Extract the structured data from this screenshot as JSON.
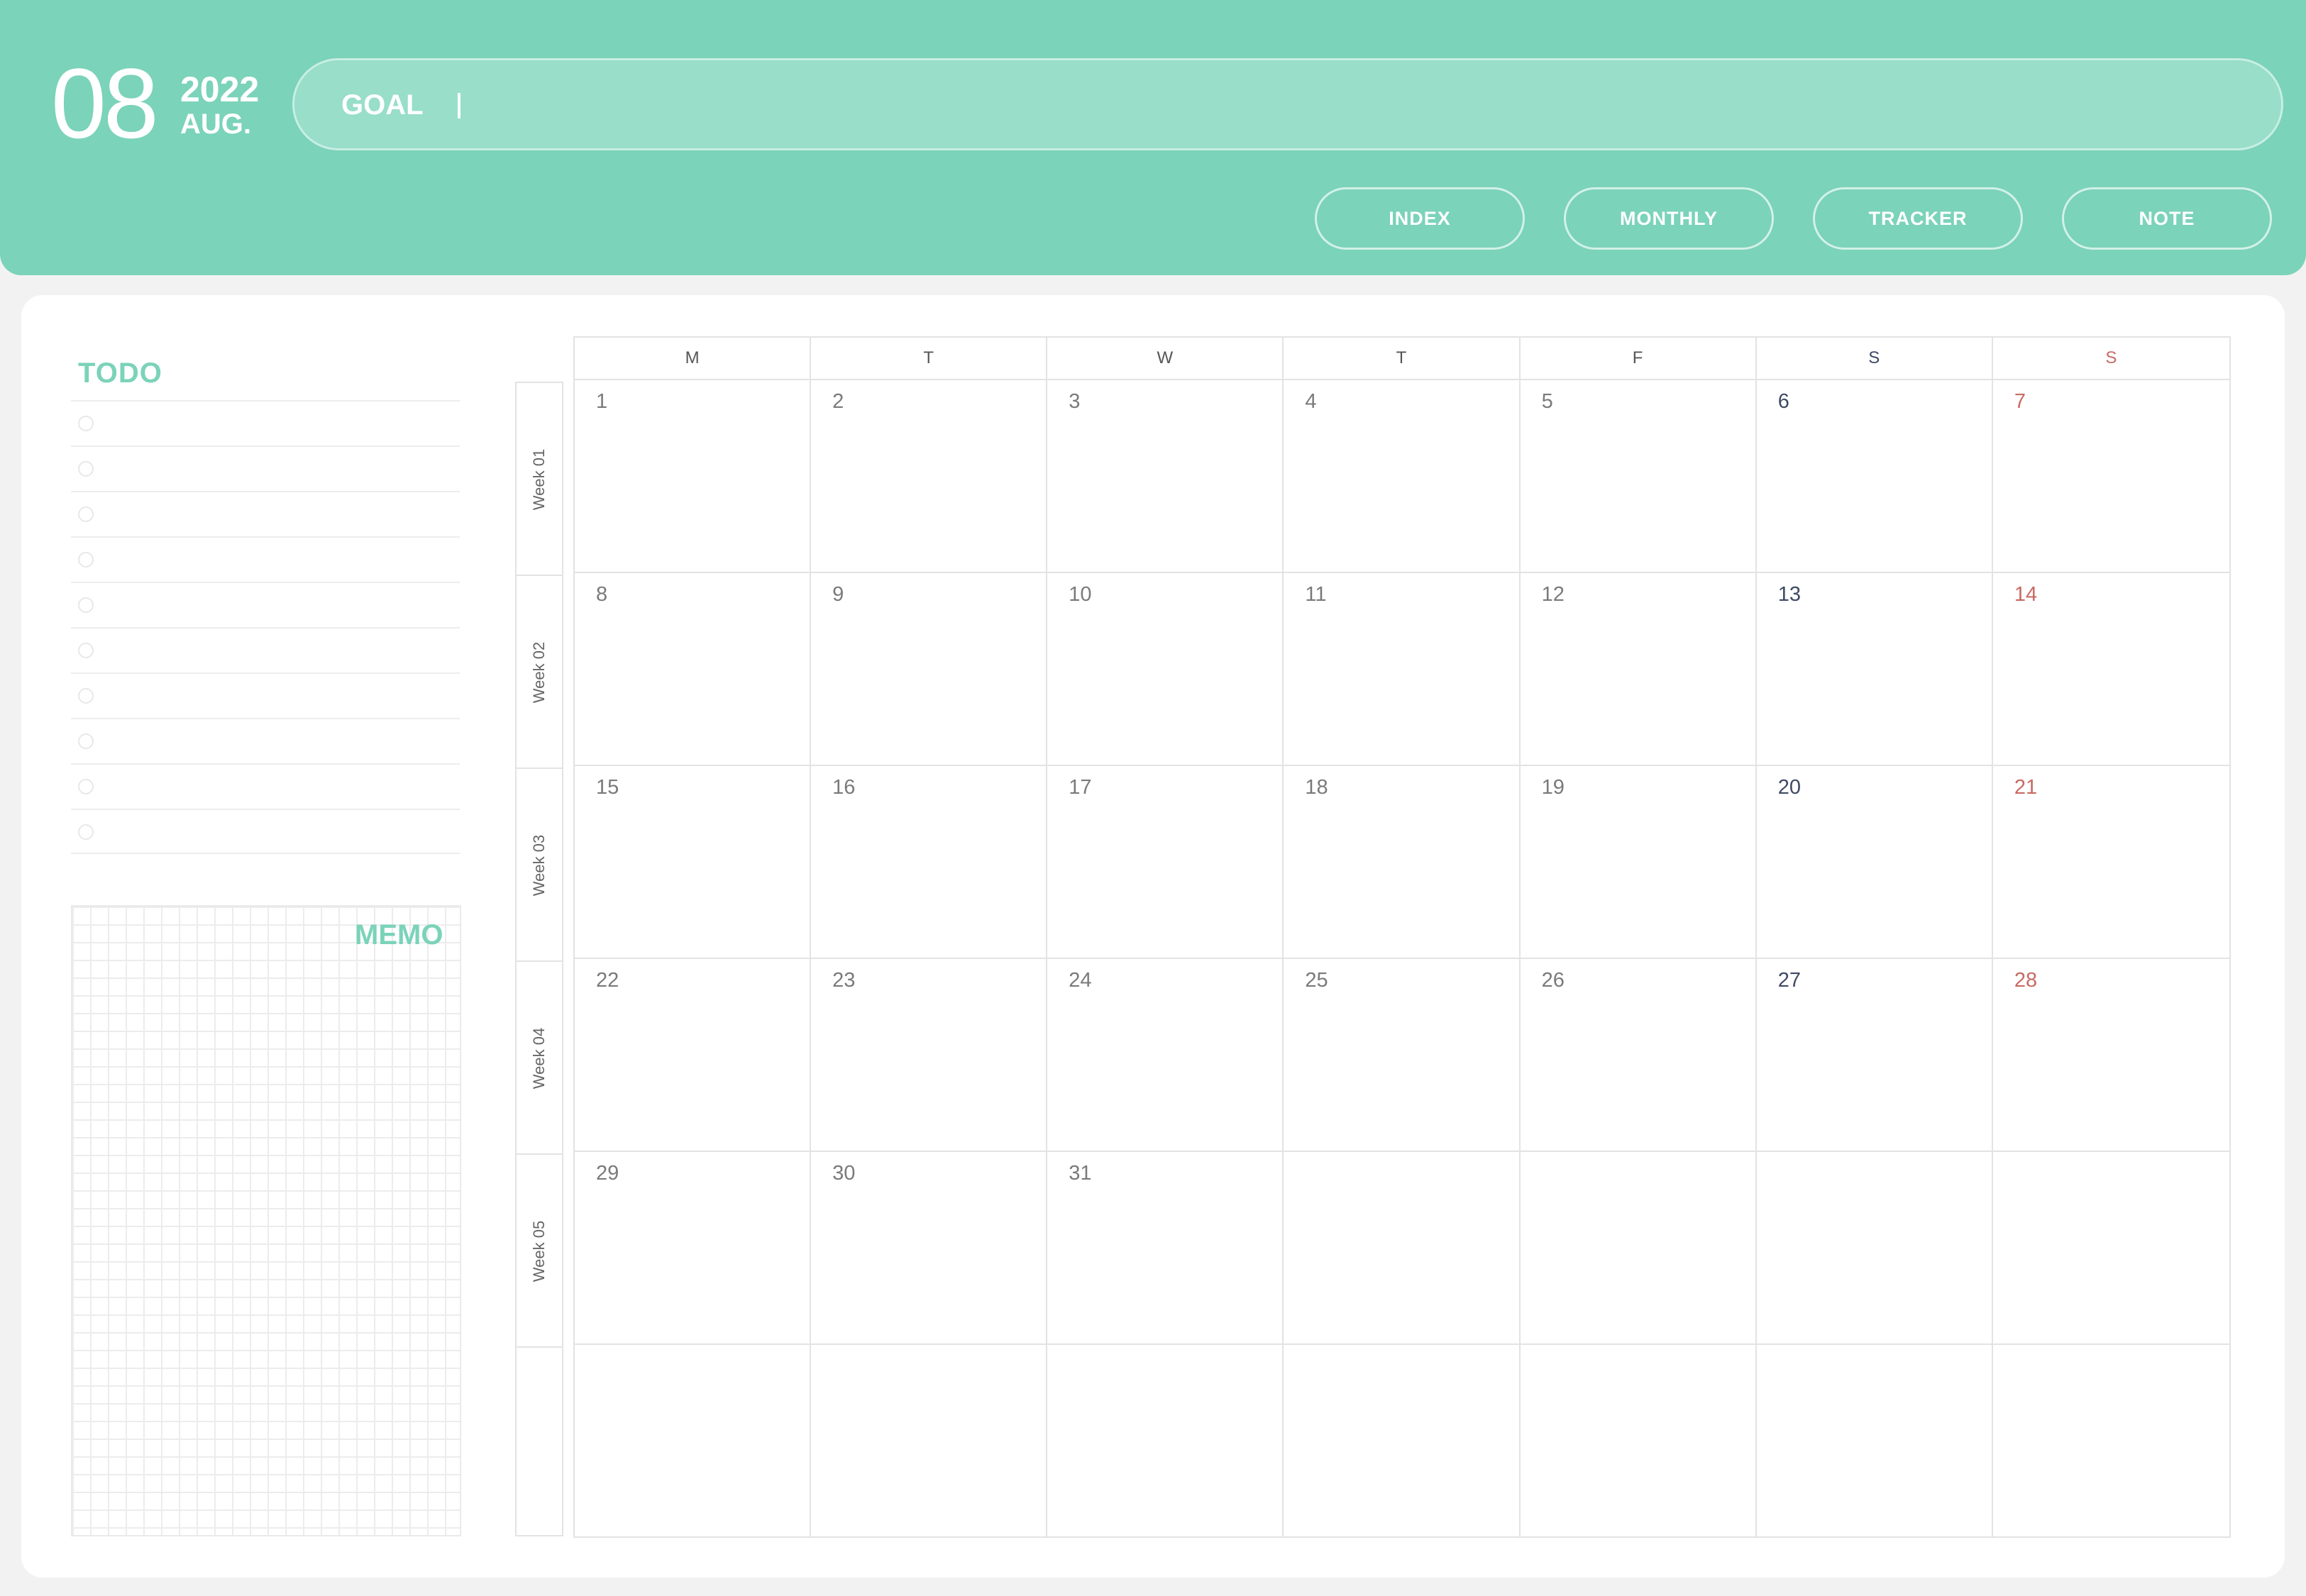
{
  "header": {
    "day": "08",
    "year": "2022",
    "month": "AUG.",
    "goal_label": "GOAL",
    "goal_value": "",
    "nav": [
      "INDEX",
      "MONTHLY",
      "TRACKER",
      "NOTE"
    ]
  },
  "todo": {
    "title": "TODO",
    "items": [
      "",
      "",
      "",
      "",
      "",
      "",
      "",
      "",
      "",
      ""
    ]
  },
  "memo": {
    "title": "MEMO"
  },
  "calendar": {
    "weekday_headers": [
      "M",
      "T",
      "W",
      "T",
      "F",
      "S",
      "S"
    ],
    "week_labels": [
      "Week 01",
      "Week 02",
      "Week 03",
      "Week 04",
      "Week 05",
      ""
    ],
    "weeks": [
      [
        "1",
        "2",
        "3",
        "4",
        "5",
        "6",
        "7"
      ],
      [
        "8",
        "9",
        "10",
        "11",
        "12",
        "13",
        "14"
      ],
      [
        "15",
        "16",
        "17",
        "18",
        "19",
        "20",
        "21"
      ],
      [
        "22",
        "23",
        "24",
        "25",
        "26",
        "27",
        "28"
      ],
      [
        "29",
        "30",
        "31",
        "",
        "",
        "",
        ""
      ],
      [
        "",
        "",
        "",
        "",
        "",
        "",
        ""
      ]
    ]
  },
  "colors": {
    "accent": "#7bd3b9",
    "saturday": "#3f4a63",
    "sunday": "#c86a62",
    "weekday": "#7a7a7a"
  }
}
